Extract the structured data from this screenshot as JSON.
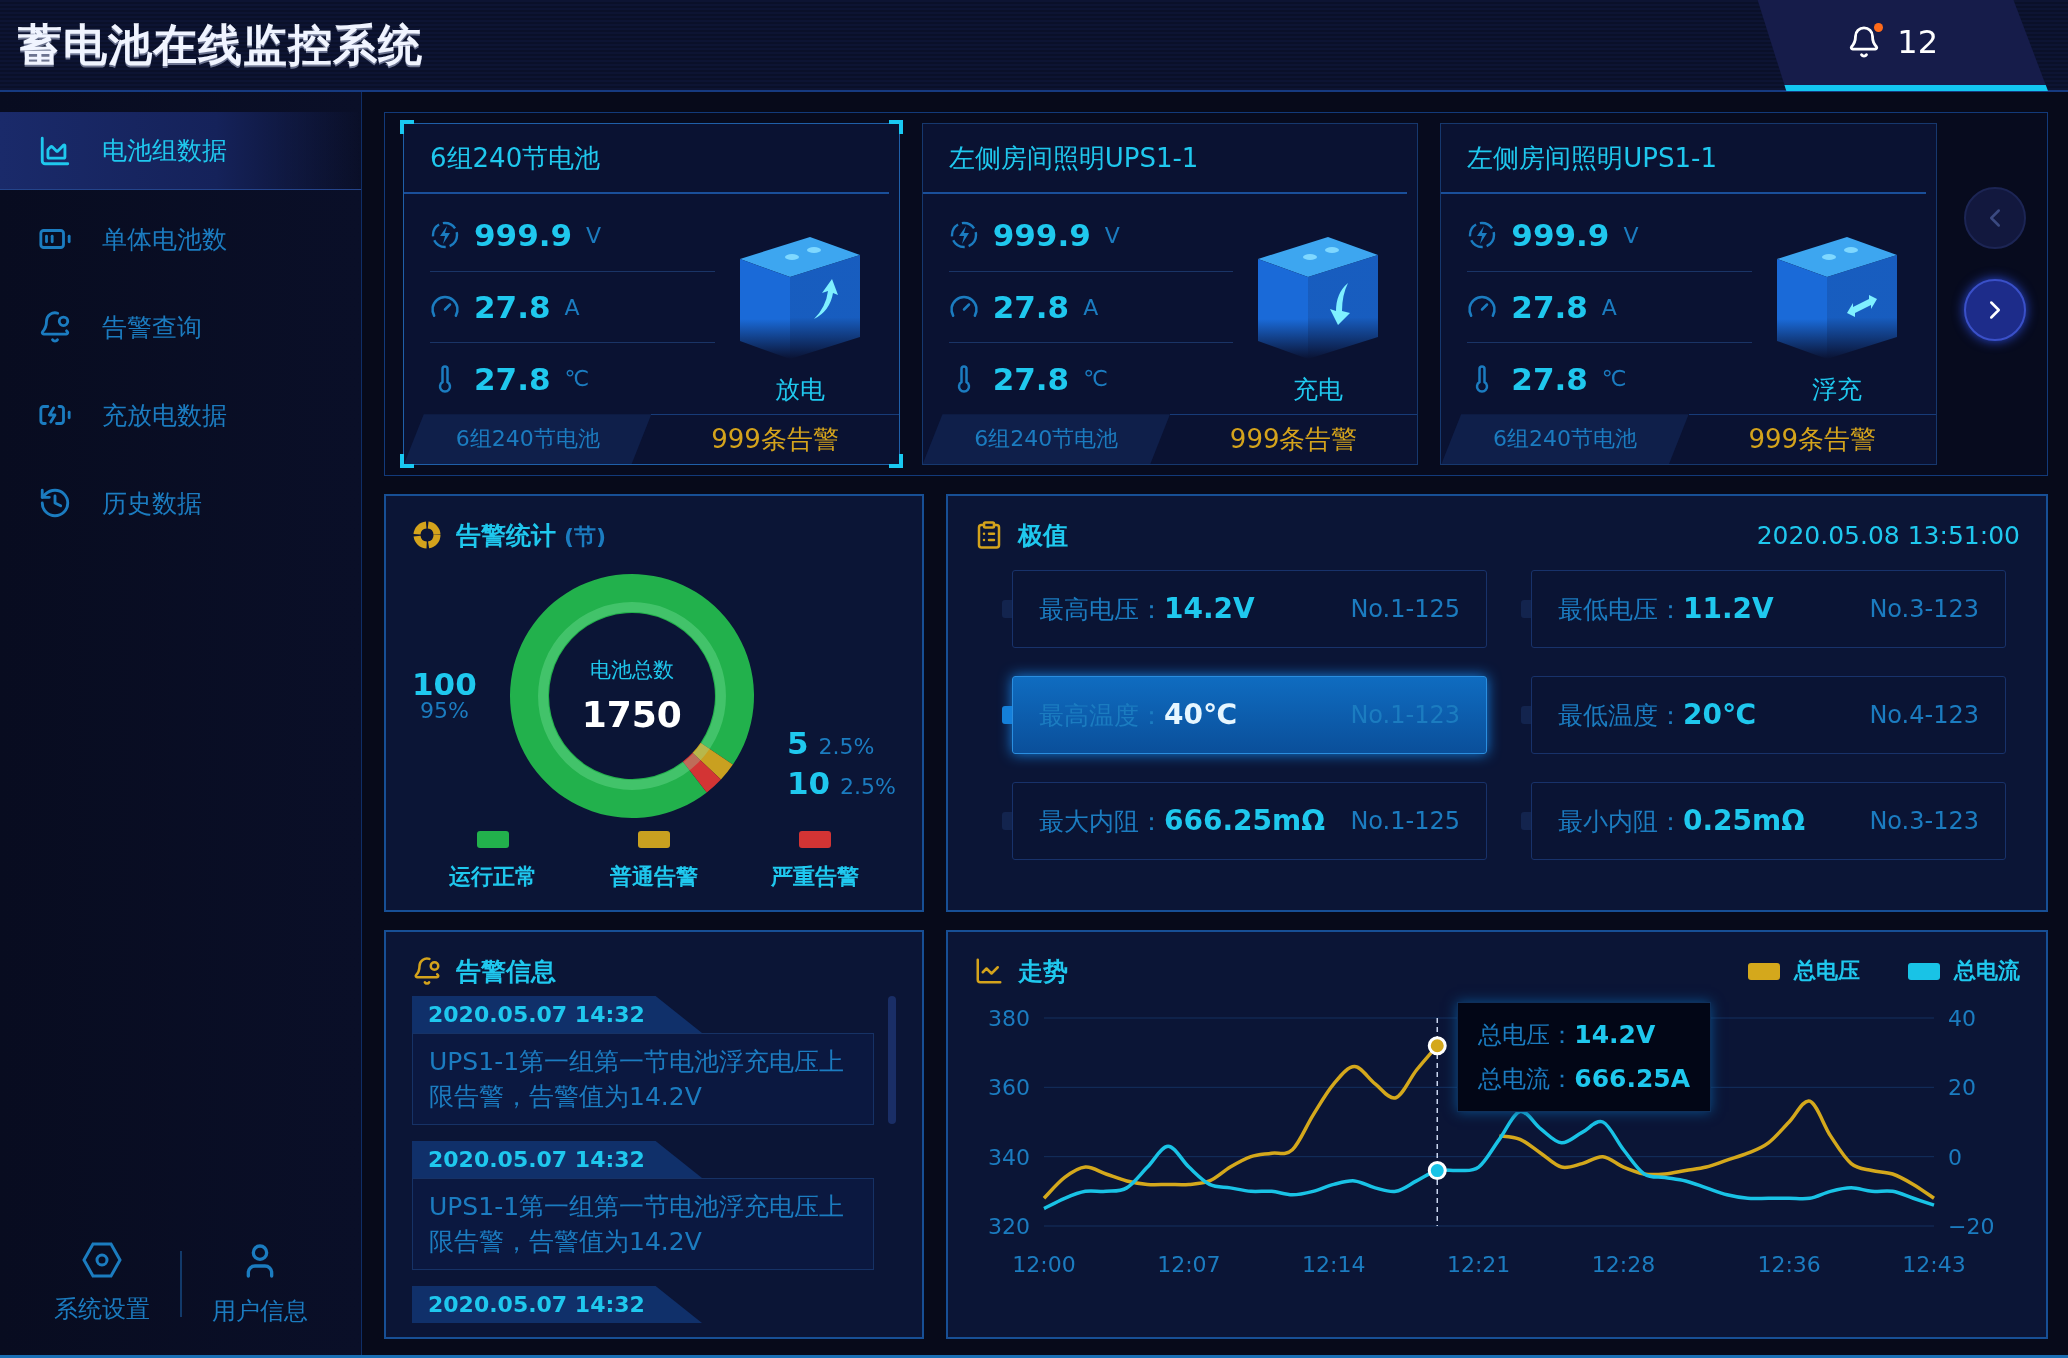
{
  "header": {
    "title": "蓄电池在线监控系统",
    "notification_count": "12"
  },
  "sidebar": {
    "items": [
      {
        "label": "电池组数据",
        "selected": true
      },
      {
        "label": "单体电池数",
        "selected": false
      },
      {
        "label": "告警查询",
        "selected": false
      },
      {
        "label": "充放电数据",
        "selected": false
      },
      {
        "label": "历史数据",
        "selected": false
      }
    ],
    "footer": [
      {
        "label": "系统设置"
      },
      {
        "label": "用户信息"
      }
    ]
  },
  "battery_cards": {
    "cards": [
      {
        "title": "6组240节电池",
        "selected": true,
        "voltage": "999.9",
        "voltage_unit": "V",
        "current": "27.8",
        "current_unit": "A",
        "temperature": "27.8",
        "temperature_unit": "℃",
        "status": "放电",
        "kind": "discharge",
        "group": "6组240节电池",
        "alarms": "999条告警"
      },
      {
        "title": "左侧房间照明UPS1-1",
        "selected": false,
        "voltage": "999.9",
        "voltage_unit": "V",
        "current": "27.8",
        "current_unit": "A",
        "temperature": "27.8",
        "temperature_unit": "℃",
        "status": "充电",
        "kind": "charge",
        "group": "6组240节电池",
        "alarms": "999条告警"
      },
      {
        "title": "左侧房间照明UPS1-1",
        "selected": false,
        "voltage": "999.9",
        "voltage_unit": "V",
        "current": "27.8",
        "current_unit": "A",
        "temperature": "27.8",
        "temperature_unit": "℃",
        "status": "浮充",
        "kind": "float",
        "group": "6组240节电池",
        "alarms": "999条告警"
      }
    ],
    "prev": {
      "disabled": true
    },
    "next": {
      "disabled": false
    }
  },
  "alarm_stats": {
    "title": "告警统计",
    "unit": "(节)",
    "center_label": "电池总数",
    "center_value": "1750",
    "slices": [
      {
        "value": "100",
        "percent": "95%"
      },
      {
        "value": "5",
        "percent": "2.5%"
      },
      {
        "value": "10",
        "percent": "2.5%"
      }
    ],
    "legend": [
      {
        "color": "#22b14c"
      },
      {
        "color": "#c9a020"
      },
      {
        "color": "#d33434"
      }
    ],
    "chart_data": {
      "type": "donut",
      "categories": [
        "运行正常",
        "普通告警",
        "严重告警"
      ],
      "values": [
        95,
        2.5,
        2.5
      ]
    }
  },
  "extremes": {
    "title": "极值",
    "timestamp": "2020.05.08 13:51:00",
    "items": [
      {
        "label": "最高电压：",
        "value": "14.2V",
        "cell": "No.1-125",
        "selected": false
      },
      {
        "label": "最低电压：",
        "value": "11.2V",
        "cell": "No.3-123",
        "selected": false
      },
      {
        "label": "最高温度：",
        "value": "40℃",
        "cell": "No.1-123",
        "selected": true
      },
      {
        "label": "最低温度：",
        "value": "20℃",
        "cell": "No.4-123",
        "selected": false
      },
      {
        "label": "最大内阻：",
        "value": "666.25mΩ",
        "cell": "No.1-125",
        "selected": false
      },
      {
        "label": "最小内阻：",
        "value": "0.25mΩ",
        "cell": "No.3-123",
        "selected": false
      }
    ]
  },
  "alarm_info": {
    "title": "告警信息",
    "messages": [
      {
        "time": "2020.05.07 14:32",
        "text": "UPS1-1第一组第一节电池浮充电压上限告警，告警值为14.2V"
      },
      {
        "time": "2020.05.07 14:32",
        "text": "UPS1-1第一组第一节电池浮充电压上限告警，告警值为14.2V"
      },
      {
        "time": "2020.05.07 14:32"
      }
    ]
  },
  "trend": {
    "title": "走势",
    "tooltip": [
      {
        "label": "总电压：",
        "value": "14.2V"
      },
      {
        "label": "总电流：",
        "value": "666.25A"
      }
    ],
    "chart_data": {
      "type": "line",
      "categories": [
        "12:00",
        null,
        null,
        null,
        null,
        null,
        null,
        "12:07",
        null,
        null,
        null,
        null,
        null,
        null,
        "12:14",
        null,
        null,
        null,
        null,
        null,
        null,
        "12:21",
        null,
        null,
        null,
        null,
        null,
        null,
        "12:28",
        null,
        null,
        null,
        null,
        null,
        null,
        null,
        "12:36",
        null,
        null,
        null,
        null,
        null,
        null,
        "12:43"
      ],
      "series": [
        {
          "name": "总电压",
          "color": "#d4a81c",
          "values": [
            328,
            334,
            337,
            335,
            333,
            332,
            332,
            332,
            333,
            337,
            340,
            341,
            342,
            352,
            361,
            366,
            361,
            357,
            365,
            372,
            null,
            null,
            346,
            345,
            341,
            337,
            338,
            340,
            337,
            335,
            335,
            336,
            337,
            339,
            341,
            344,
            350,
            356,
            346,
            338,
            336,
            335,
            332,
            328
          ]
        },
        {
          "name": "总电流",
          "color": "#19c3e6",
          "axis": "y2",
          "values": [
            -15,
            -12,
            -10,
            -10,
            -9,
            -3,
            3,
            -3,
            -8,
            -9,
            -10,
            -10,
            -11,
            -10,
            -8,
            -7,
            -9,
            -10,
            -7,
            -4,
            -4,
            -3,
            5,
            13,
            8,
            4,
            7,
            10,
            2,
            -5,
            -6,
            -7,
            -9,
            -11,
            -12,
            -12,
            -12,
            -12,
            -10,
            -9,
            -10,
            -10,
            -12,
            -14
          ]
        }
      ],
      "ylim": [
        320,
        380
      ],
      "yticks": [
        320,
        340,
        360,
        380
      ],
      "y2lim": [
        -20,
        40
      ],
      "y2ticks": [
        {
          "value": -20,
          "label": "−20"
        },
        0,
        20,
        40
      ],
      "legend": "top-right"
    }
  }
}
